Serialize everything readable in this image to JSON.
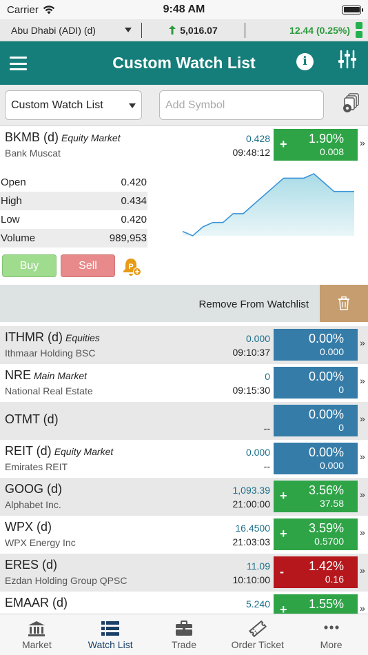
{
  "status_bar": {
    "carrier": "Carrier",
    "time": "9:48 AM"
  },
  "market_bar": {
    "exchange": "Abu Dhabi (ADI) (d)",
    "index_value": "5,016.07",
    "index_change": "12.44 (0.25%)"
  },
  "header": {
    "title": "Custom Watch List"
  },
  "toolbar": {
    "watchlist_select": "Custom Watch List",
    "symbol_placeholder": "Add Symbol"
  },
  "expanded": {
    "symbol": "BKMB (d)",
    "market": "Equity Market",
    "name": "Bank Muscat",
    "price": "0.428",
    "time": "09:48:12",
    "sign": "+",
    "pct": "1.90%",
    "abs": "0.008",
    "direction": "up",
    "stats": [
      {
        "label": "Open",
        "value": "0.420"
      },
      {
        "label": "High",
        "value": "0.434"
      },
      {
        "label": "Low",
        "value": "0.420"
      },
      {
        "label": "Volume",
        "value": "989,953"
      }
    ],
    "buy_label": "Buy",
    "sell_label": "Sell",
    "chart_data": {
      "type": "area",
      "values": [
        0.421,
        0.42,
        0.422,
        0.423,
        0.423,
        0.425,
        0.425,
        0.427,
        0.429,
        0.431,
        0.433,
        0.433,
        0.433,
        0.434,
        0.432,
        0.43,
        0.43,
        0.43
      ],
      "title": "",
      "xlabel": "",
      "ylabel": ""
    }
  },
  "remove": {
    "label": "Remove From Watchlist"
  },
  "rows": [
    {
      "symbol": "ITHMR (d)",
      "market": "Equities",
      "name": "Ithmaar Holding BSC",
      "price": "0.000",
      "time": "09:10:37",
      "sign": "",
      "pct": "0.00%",
      "abs": "0.000",
      "direction": "flat"
    },
    {
      "symbol": "NRE",
      "market": "Main Market",
      "name": "National Real Estate",
      "price": "0",
      "time": "09:15:30",
      "sign": "",
      "pct": "0.00%",
      "abs": "0",
      "direction": "flat"
    },
    {
      "symbol": "OTMT (d)",
      "market": "",
      "name": "",
      "price": "",
      "time": "--",
      "sign": "",
      "pct": "0.00%",
      "abs": "0",
      "direction": "flat"
    },
    {
      "symbol": "REIT (d)",
      "market": "Equity Market",
      "name": "Emirates REIT",
      "price": "0.000",
      "time": "--",
      "sign": "",
      "pct": "0.00%",
      "abs": "0.000",
      "direction": "flat"
    },
    {
      "symbol": "GOOG (d)",
      "market": "",
      "name": "Alphabet Inc.",
      "price": "1,093.39",
      "time": "21:00:00",
      "sign": "+",
      "pct": "3.56%",
      "abs": "37.58",
      "direction": "up"
    },
    {
      "symbol": "WPX (d)",
      "market": "",
      "name": "WPX Energy Inc",
      "price": "16.4500",
      "time": "21:03:03",
      "sign": "+",
      "pct": "3.59%",
      "abs": "0.5700",
      "direction": "up"
    },
    {
      "symbol": "ERES (d)",
      "market": "",
      "name": "Ezdan Holding Group QPSC",
      "price": "11.09",
      "time": "10:10:00",
      "sign": "-",
      "pct": "1.42%",
      "abs": "0.16",
      "direction": "down"
    },
    {
      "symbol": "EMAAR (d)",
      "market": "",
      "name": "",
      "price": "5.240",
      "time": "",
      "sign": "+",
      "pct": "1.55%",
      "abs": "",
      "direction": "up"
    }
  ],
  "tabs": [
    {
      "label": "Market",
      "icon": "bank-icon",
      "active": false
    },
    {
      "label": "Watch List",
      "icon": "list-icon",
      "active": true
    },
    {
      "label": "Trade",
      "icon": "briefcase-icon",
      "active": false
    },
    {
      "label": "Order Ticket",
      "icon": "ticket-icon",
      "active": false
    },
    {
      "label": "More",
      "icon": "more-dots-icon",
      "active": false
    }
  ],
  "colors": {
    "header": "#157e7a",
    "up": "#2ea447",
    "down": "#b5171c",
    "flat": "#357ca8",
    "trash": "#c59d6f"
  }
}
